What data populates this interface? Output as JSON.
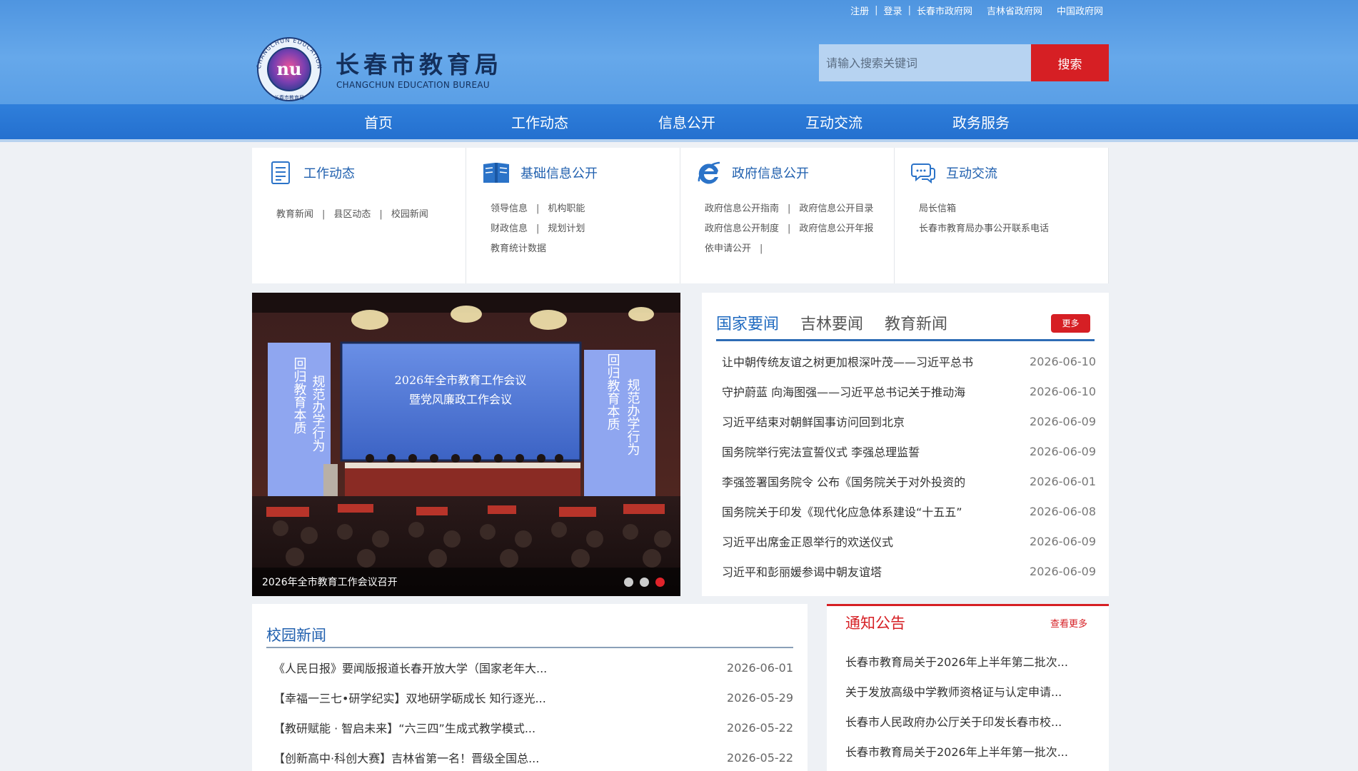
{
  "top_links": [
    "注册",
    "登录",
    "长春市政府网",
    "吉林省政府网",
    "中国政府网"
  ],
  "site": {
    "title": "长春市教育局",
    "subtitle": "CHANGCHUN EDUCATION BUREAU",
    "logo_ring_text": "CHANGCHUN EDUCATION BUREAU",
    "logo_bottom_text": "长春市教育局"
  },
  "search": {
    "placeholder": "请输入搜索关键词",
    "button": "搜索"
  },
  "nav": [
    "首页",
    "工作动态",
    "信息公开",
    "互动交流",
    "政务服务"
  ],
  "categories": [
    {
      "title": "工作动态",
      "icon": "document-icon",
      "rows": [
        [
          "教育新闻",
          "县区动态",
          "校园新闻"
        ]
      ]
    },
    {
      "title": "基础信息公开",
      "icon": "book-icon",
      "rows": [
        [
          "领导信息",
          "机构职能"
        ],
        [
          "财政信息",
          "规划计划"
        ],
        [
          "教育统计数据"
        ]
      ]
    },
    {
      "title": "政府信息公开",
      "icon": "browser-e-icon",
      "rows": [
        [
          "政府信息公开指南",
          "政府信息公开目录"
        ],
        [
          "政府信息公开制度",
          "政府信息公开年报"
        ],
        [
          "依申请公开"
        ]
      ]
    },
    {
      "title": "互动交流",
      "icon": "chat-icon",
      "rows": [
        [
          "局长信箱"
        ],
        [
          "长春市教育局办事公开联系电话"
        ]
      ]
    }
  ],
  "slider": {
    "caption": "2026年全市教育工作会议召开",
    "screen_title_1": "2026年全市教育工作会议",
    "screen_title_2": "暨党风廉政工作会议",
    "banner_left": "回归教育本质",
    "banner_left_2": "规范办学行为",
    "banner_right": "回归教育本质",
    "banner_right_2": "规范办学行为",
    "dots": 3,
    "active_dot": 3
  },
  "news": {
    "tabs": [
      "国家要闻",
      "吉林要闻",
      "教育新闻"
    ],
    "active_tab": 0,
    "more": "更多",
    "items": [
      {
        "title": "让中朝传统友谊之树更加根深叶茂——习近平总书",
        "date": "2026-06-10"
      },
      {
        "title": "守护蔚蓝 向海图强——习近平总书记关于推动海",
        "date": "2026-06-10"
      },
      {
        "title": "习近平结束对朝鲜国事访问回到北京",
        "date": "2026-06-09"
      },
      {
        "title": "国务院举行宪法宣誓仪式 李强总理监誓",
        "date": "2026-06-09"
      },
      {
        "title": "李强签署国务院令 公布《国务院关于对外投资的",
        "date": "2026-06-01"
      },
      {
        "title": "国务院关于印发《现代化应急体系建设“十五五”",
        "date": "2026-06-08"
      },
      {
        "title": "习近平出席金正恩举行的欢送仪式",
        "date": "2026-06-09"
      },
      {
        "title": "习近平和彭丽媛参谒中朝友谊塔",
        "date": "2026-06-09"
      }
    ]
  },
  "campus": {
    "title": "校园新闻",
    "items": [
      {
        "title": "《人民日报》要闻版报道长春开放大学（国家老年大...",
        "date": "2026-06-01"
      },
      {
        "title": "【幸福一三七•研学纪实】双地研学砺成长 知行逐光...",
        "date": "2026-05-29"
      },
      {
        "title": "【教研赋能 · 智启未来】“六三四”生成式教学模式...",
        "date": "2026-05-22"
      },
      {
        "title": "【创新高中·科创大赛】吉林省第一名！晋级全国总...",
        "date": "2026-05-22"
      }
    ]
  },
  "notices": {
    "title": "通知公告",
    "more": "查看更多",
    "items": [
      "长春市教育局关于2026年上半年第二批次...",
      "关于发放高级中学教师资格证与认定申请...",
      "长春市人民政府办公厅关于印发长春市校...",
      "长春市教育局关于2026年上半年第一批次..."
    ]
  },
  "colors": {
    "header_blue": "#5a9fe6",
    "nav_blue": "#2a77d5",
    "accent_red": "#d61f24",
    "link_blue": "#1f5fae"
  }
}
